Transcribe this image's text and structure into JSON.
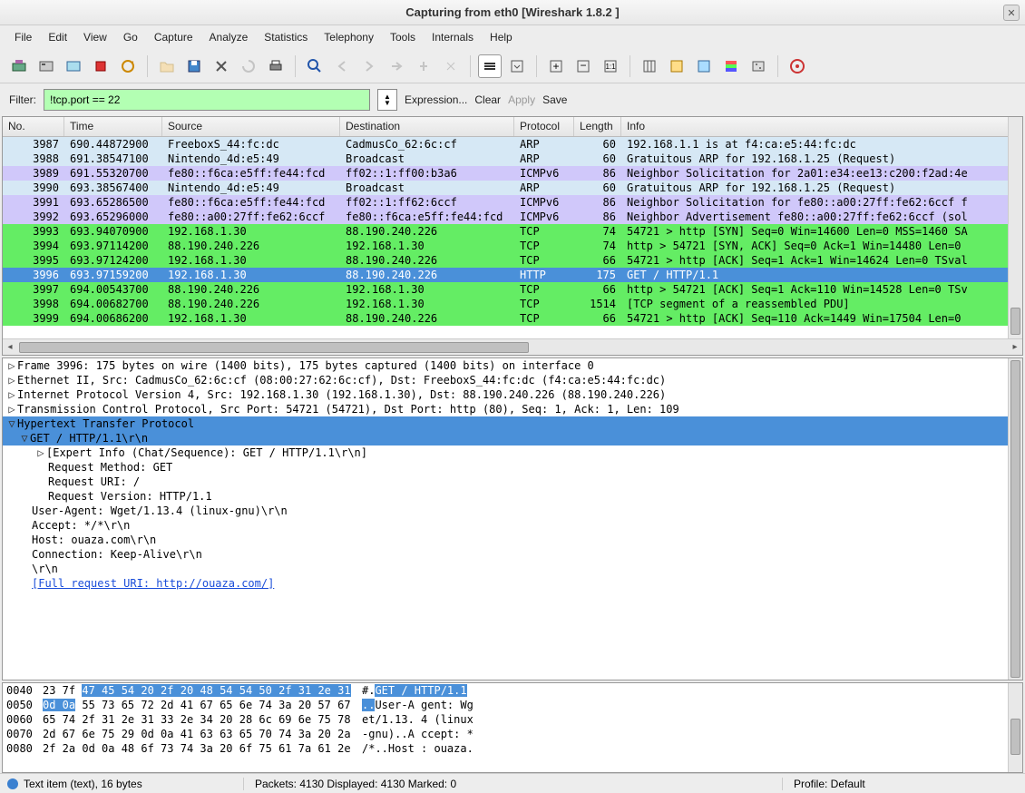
{
  "window": {
    "title": "Capturing from eth0    [Wireshark 1.8.2 ]"
  },
  "menubar": [
    "File",
    "Edit",
    "View",
    "Go",
    "Capture",
    "Analyze",
    "Statistics",
    "Telephony",
    "Tools",
    "Internals",
    "Help"
  ],
  "filter": {
    "label": "Filter:",
    "value": "!tcp.port == 22",
    "expression": "Expression...",
    "clear": "Clear",
    "apply": "Apply",
    "save": "Save"
  },
  "columns": [
    "No.",
    "Time",
    "Source",
    "Destination",
    "Protocol",
    "Length",
    "Info"
  ],
  "packets": [
    {
      "no": "3987",
      "time": "690.44872900",
      "src": "FreeboxS_44:fc:dc",
      "dst": "CadmusCo_62:6c:cf",
      "proto": "ARP",
      "len": "60",
      "info": "192.168.1.1 is at f4:ca:e5:44:fc:dc",
      "cls": "row-arp"
    },
    {
      "no": "3988",
      "time": "691.38547100",
      "src": "Nintendo_4d:e5:49",
      "dst": "Broadcast",
      "proto": "ARP",
      "len": "60",
      "info": "Gratuitous ARP for 192.168.1.25 (Request)",
      "cls": "row-arp"
    },
    {
      "no": "3989",
      "time": "691.55320700",
      "src": "fe80::f6ca:e5ff:fe44:fcd",
      "dst": "ff02::1:ff00:b3a6",
      "proto": "ICMPv6",
      "len": "86",
      "info": "Neighbor Solicitation for 2a01:e34:ee13:c200:f2ad:4e",
      "cls": "row-icmpv6"
    },
    {
      "no": "3990",
      "time": "693.38567400",
      "src": "Nintendo_4d:e5:49",
      "dst": "Broadcast",
      "proto": "ARP",
      "len": "60",
      "info": "Gratuitous ARP for 192.168.1.25 (Request)",
      "cls": "row-arp"
    },
    {
      "no": "3991",
      "time": "693.65286500",
      "src": "fe80::f6ca:e5ff:fe44:fcd",
      "dst": "ff02::1:ff62:6ccf",
      "proto": "ICMPv6",
      "len": "86",
      "info": "Neighbor Solicitation for fe80::a00:27ff:fe62:6ccf f",
      "cls": "row-icmpv6"
    },
    {
      "no": "3992",
      "time": "693.65296000",
      "src": "fe80::a00:27ff:fe62:6ccf",
      "dst": "fe80::f6ca:e5ff:fe44:fcd",
      "proto": "ICMPv6",
      "len": "86",
      "info": "Neighbor Advertisement fe80::a00:27ff:fe62:6ccf (sol",
      "cls": "row-icmpv6"
    },
    {
      "no": "3993",
      "time": "693.94070900",
      "src": "192.168.1.30",
      "dst": "88.190.240.226",
      "proto": "TCP",
      "len": "74",
      "info": "54721 > http [SYN] Seq=0 Win=14600 Len=0 MSS=1460 SA",
      "cls": "row-tcp"
    },
    {
      "no": "3994",
      "time": "693.97114200",
      "src": "88.190.240.226",
      "dst": "192.168.1.30",
      "proto": "TCP",
      "len": "74",
      "info": "http > 54721 [SYN, ACK] Seq=0 Ack=1 Win=14480 Len=0",
      "cls": "row-tcp"
    },
    {
      "no": "3995",
      "time": "693.97124200",
      "src": "192.168.1.30",
      "dst": "88.190.240.226",
      "proto": "TCP",
      "len": "66",
      "info": "54721 > http [ACK] Seq=1 Ack=1 Win=14624 Len=0 TSval",
      "cls": "row-tcp"
    },
    {
      "no": "3996",
      "time": "693.97159200",
      "src": "192.168.1.30",
      "dst": "88.190.240.226",
      "proto": "HTTP",
      "len": "175",
      "info": "GET / HTTP/1.1",
      "cls": "row-http-sel"
    },
    {
      "no": "3997",
      "time": "694.00543700",
      "src": "88.190.240.226",
      "dst": "192.168.1.30",
      "proto": "TCP",
      "len": "66",
      "info": "http > 54721 [ACK] Seq=1 Ack=110 Win=14528 Len=0 TSv",
      "cls": "row-tcp"
    },
    {
      "no": "3998",
      "time": "694.00682700",
      "src": "88.190.240.226",
      "dst": "192.168.1.30",
      "proto": "TCP",
      "len": "1514",
      "info": "[TCP segment of a reassembled PDU]",
      "cls": "row-tcp"
    },
    {
      "no": "3999",
      "time": "694.00686200",
      "src": "192.168.1.30",
      "dst": "88.190.240.226",
      "proto": "TCP",
      "len": "66",
      "info": "54721 > http [ACK] Seq=110 Ack=1449 Win=17504 Len=0",
      "cls": "row-tcp"
    }
  ],
  "details": {
    "frame": "Frame 3996: 175 bytes on wire (1400 bits), 175 bytes captured (1400 bits) on interface 0",
    "eth": "Ethernet II, Src: CadmusCo_62:6c:cf (08:00:27:62:6c:cf), Dst: FreeboxS_44:fc:dc (f4:ca:e5:44:fc:dc)",
    "ip": "Internet Protocol Version 4, Src: 192.168.1.30 (192.168.1.30), Dst: 88.190.240.226 (88.190.240.226)",
    "tcp": "Transmission Control Protocol, Src Port: 54721 (54721), Dst Port: http (80), Seq: 1, Ack: 1, Len: 109",
    "http": "Hypertext Transfer Protocol",
    "get": "GET / HTTP/1.1\\r\\n",
    "expert": "[Expert Info (Chat/Sequence): GET / HTTP/1.1\\r\\n]",
    "method": "Request Method: GET",
    "uri": "Request URI: /",
    "version": "Request Version: HTTP/1.1",
    "ua": "User-Agent: Wget/1.13.4 (linux-gnu)\\r\\n",
    "accept": "Accept: */*\\r\\n",
    "host": "Host: ouaza.com\\r\\n",
    "conn": "Connection: Keep-Alive\\r\\n",
    "crlf": "\\r\\n",
    "fulluri": "[Full request URI: http://ouaza.com/]"
  },
  "hex": [
    {
      "off": "0040",
      "b1": "23 7f ",
      "b2": "47 45 54 20 2f 20  48 54 54 50 2f 31 2e 31",
      "a1": "#.",
      "a2": "GET /  HTTP/1.1"
    },
    {
      "off": "0050",
      "b1": "",
      "b2": "0d 0a",
      "b3": " 55 73 65 72 2d 41  67 65 6e 74 3a 20 57 67",
      "a1": "",
      "a2": "..",
      "a3": "User-A gent: Wg"
    },
    {
      "off": "0060",
      "b1": "65 74 2f 31 2e 31 33 2e  34 20 28 6c 69 6e 75 78",
      "a1": "et/1.13. 4 (linux"
    },
    {
      "off": "0070",
      "b1": "2d 67 6e 75 29 0d 0a 41  63 63 65 70 74 3a 20 2a",
      "a1": "-gnu)..A ccept: *"
    },
    {
      "off": "0080",
      "b1": "2f 2a 0d 0a 48 6f 73 74  3a 20 6f 75 61 7a 61 2e",
      "a1": "/*..Host : ouaza."
    }
  ],
  "status": {
    "left": "Text item (text), 16 bytes",
    "mid": "Packets: 4130 Displayed: 4130 Marked: 0",
    "right": "Profile: Default"
  }
}
